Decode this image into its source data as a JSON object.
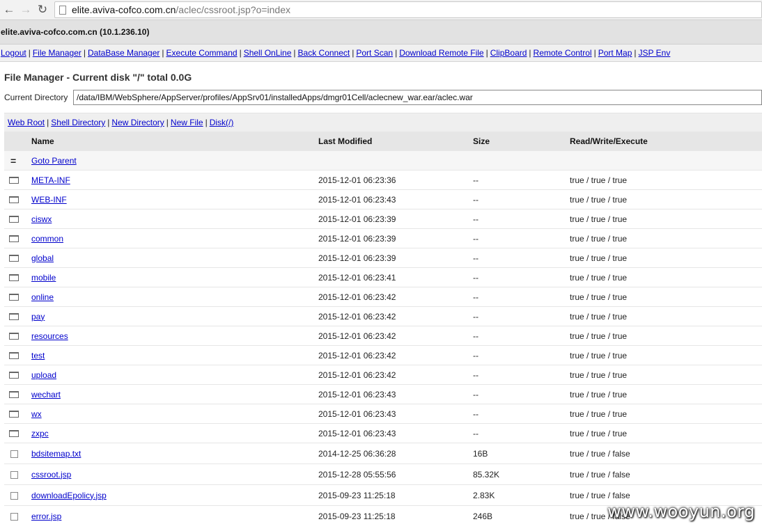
{
  "browser": {
    "url_host": "elite.aviva-cofco.com.cn",
    "url_path": "/aclec/cssroot.jsp?o=index"
  },
  "host_label": "elite.aviva-cofco.com.cn (10.1.236.10)",
  "menu": [
    "Logout",
    "File Manager",
    "DataBase Manager",
    "Execute Command",
    "Shell OnLine",
    "Back Connect",
    "Port Scan",
    "Download Remote File",
    "ClipBoard",
    "Remote Control",
    "Port Map",
    "JSP Env"
  ],
  "fm_title": "File Manager - Current disk \"/\" total 0.0G",
  "current_directory": {
    "label": "Current Directory",
    "value": "/data/IBM/WebSphere/AppServer/profiles/AppSrv01/installedApps/dmgr01Cell/aclecnew_war.ear/aclec.war"
  },
  "toolbar": [
    "Web Root",
    "Shell Directory",
    "New Directory",
    "New File",
    "Disk(/)"
  ],
  "table": {
    "headers": [
      "Name",
      "Last Modified",
      "Size",
      "Read/Write/Execute"
    ],
    "parent_icon": "=",
    "parent_label": "Goto Parent",
    "folders": [
      {
        "name": "META-INF",
        "modified": "2015-12-01 06:23:36",
        "size": "--",
        "rwx": "true / true / true"
      },
      {
        "name": "WEB-INF",
        "modified": "2015-12-01 06:23:43",
        "size": "--",
        "rwx": "true / true / true"
      },
      {
        "name": "ciswx",
        "modified": "2015-12-01 06:23:39",
        "size": "--",
        "rwx": "true / true / true"
      },
      {
        "name": "common",
        "modified": "2015-12-01 06:23:39",
        "size": "--",
        "rwx": "true / true / true"
      },
      {
        "name": "global",
        "modified": "2015-12-01 06:23:39",
        "size": "--",
        "rwx": "true / true / true"
      },
      {
        "name": "mobile",
        "modified": "2015-12-01 06:23:41",
        "size": "--",
        "rwx": "true / true / true"
      },
      {
        "name": "online",
        "modified": "2015-12-01 06:23:42",
        "size": "--",
        "rwx": "true / true / true"
      },
      {
        "name": "pay",
        "modified": "2015-12-01 06:23:42",
        "size": "--",
        "rwx": "true / true / true"
      },
      {
        "name": "resources",
        "modified": "2015-12-01 06:23:42",
        "size": "--",
        "rwx": "true / true / true"
      },
      {
        "name": "test",
        "modified": "2015-12-01 06:23:42",
        "size": "--",
        "rwx": "true / true / true"
      },
      {
        "name": "upload",
        "modified": "2015-12-01 06:23:42",
        "size": "--",
        "rwx": "true / true / true"
      },
      {
        "name": "wechart",
        "modified": "2015-12-01 06:23:43",
        "size": "--",
        "rwx": "true / true / true"
      },
      {
        "name": "wx",
        "modified": "2015-12-01 06:23:43",
        "size": "--",
        "rwx": "true / true / true"
      },
      {
        "name": "zxpc",
        "modified": "2015-12-01 06:23:43",
        "size": "--",
        "rwx": "true / true / true"
      }
    ],
    "files": [
      {
        "name": "bdsitemap.txt",
        "modified": "2014-12-25 06:36:28",
        "size": "16B",
        "rwx": "true / true / false"
      },
      {
        "name": "cssroot.jsp",
        "modified": "2015-12-28 05:55:56",
        "size": "85.32K",
        "rwx": "true / true / false"
      },
      {
        "name": "downloadEpolicy.jsp",
        "modified": "2015-09-23 11:25:18",
        "size": "2.83K",
        "rwx": "true / true / false"
      },
      {
        "name": "error.jsp",
        "modified": "2015-09-23 11:25:18",
        "size": "246B",
        "rwx": "true / true / false"
      }
    ]
  },
  "watermark": "www.wooyun.org"
}
